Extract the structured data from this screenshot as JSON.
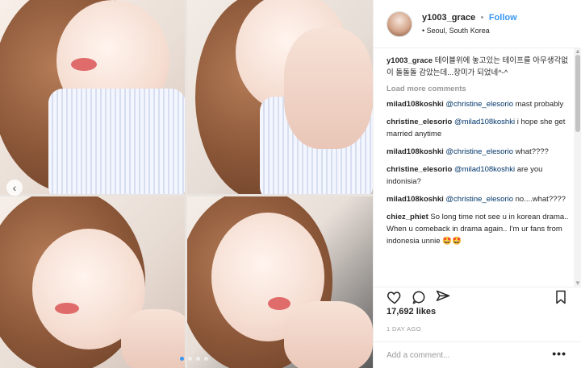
{
  "header": {
    "username": "y1003_grace",
    "separator": "•",
    "follow_label": "Follow",
    "location": "• Seoul, South Korea"
  },
  "media": {
    "prev_icon": "chevron-left-icon",
    "carousel_index": 0,
    "carousel_count": 4
  },
  "caption": {
    "user": "y1003_grace",
    "text": "테이블위에 놓고있는 테이프를 아무생각없이 돌돌돌 감았는데...장미가 되었네^-^"
  },
  "load_more_label": "Load more comments",
  "comments": [
    {
      "user": "milad108koshki",
      "mention": "@christine_elesorio",
      "text": " mast probably"
    },
    {
      "user": "christine_elesorio",
      "mention": "@milad108koshki",
      "text": " i hope she get married anytime"
    },
    {
      "user": "milad108koshki",
      "mention": "@christine_elesorio",
      "text": " what????"
    },
    {
      "user": "christine_elesorio",
      "mention": "@milad108koshki",
      "text": " are you indonisia?"
    },
    {
      "user": "milad108koshki",
      "mention": "@christine_elesorio",
      "text": " no....what????"
    },
    {
      "user": "chiez_phiet",
      "mention": "",
      "text": "So long time not see u in korean drama.. When u comeback in drama again.. I'm ur fans from indonesia unnie 🤩🤩"
    }
  ],
  "actions": {
    "like_icon": "heart-icon",
    "comment_icon": "comment-icon",
    "share_icon": "share-icon",
    "save_icon": "bookmark-icon"
  },
  "likes_label": "17,692 likes",
  "time_ago": "1 DAY AGO",
  "add_comment_placeholder": "Add a comment...",
  "more_label": "•••"
}
